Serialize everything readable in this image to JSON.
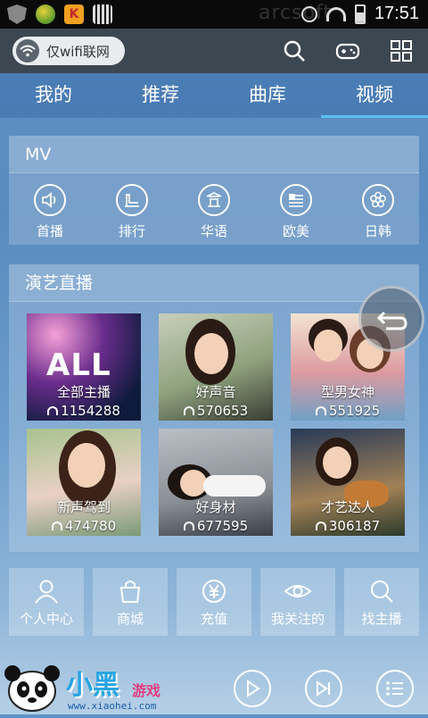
{
  "status_bar": {
    "time": "17:51",
    "watermark": "arcsoft"
  },
  "top_bar": {
    "wifi_only_label": "仅wifi联网",
    "icons": [
      "wifi-icon",
      "search-icon",
      "gamepad-icon",
      "grid-icon"
    ]
  },
  "tabs": [
    {
      "label": "我的",
      "active": false
    },
    {
      "label": "推荐",
      "active": false
    },
    {
      "label": "曲库",
      "active": false
    },
    {
      "label": "视频",
      "active": true
    }
  ],
  "mv": {
    "title": "MV",
    "items": [
      {
        "label": "首播",
        "icon": "speaker-icon"
      },
      {
        "label": "排行",
        "icon": "chart-icon"
      },
      {
        "label": "华语",
        "icon": "temple-icon"
      },
      {
        "label": "欧美",
        "icon": "flag-icon"
      },
      {
        "label": "日韩",
        "icon": "flower-icon"
      }
    ]
  },
  "live": {
    "title": "演艺直播",
    "cards": [
      {
        "title": "全部主播",
        "count": "1154288",
        "badge": "ALL"
      },
      {
        "title": "好声音",
        "count": "570653"
      },
      {
        "title": "型男女神",
        "count": "551925"
      },
      {
        "title": "新声驾到",
        "count": "474780"
      },
      {
        "title": "好身材",
        "count": "677595"
      },
      {
        "title": "才艺达人",
        "count": "306187"
      }
    ]
  },
  "shortcuts": [
    {
      "label": "个人中心",
      "icon": "person-icon"
    },
    {
      "label": "商城",
      "icon": "bag-icon"
    },
    {
      "label": "充值",
      "icon": "yen-icon"
    },
    {
      "label": "我关注的",
      "icon": "eye-icon"
    },
    {
      "label": "找主播",
      "icon": "search-icon"
    }
  ],
  "player": {
    "logo_text": "小黑",
    "logo_sub": "游戏",
    "logo_url": "www.xiaohei.com",
    "controls": [
      "play-icon",
      "next-icon",
      "playlist-icon"
    ]
  },
  "colors": {
    "accent": "#5bc0f2",
    "topbar": "#3d4752"
  }
}
